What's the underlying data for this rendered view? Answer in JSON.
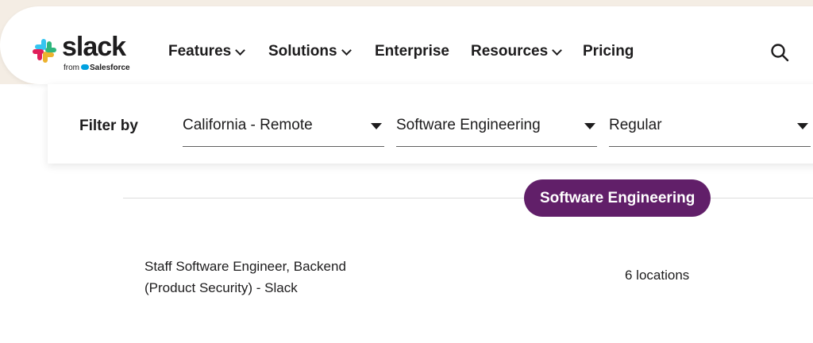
{
  "header": {
    "logo_text": "slack",
    "logo_sub_prefix": "from",
    "logo_sub_brand": "Salesforce",
    "nav": [
      {
        "label": "Features",
        "has_dropdown": true
      },
      {
        "label": "Solutions",
        "has_dropdown": true
      },
      {
        "label": "Enterprise",
        "has_dropdown": false
      },
      {
        "label": "Resources",
        "has_dropdown": true
      },
      {
        "label": "Pricing",
        "has_dropdown": false
      }
    ],
    "search_icon": "search-icon"
  },
  "filters": {
    "label": "Filter by",
    "location": "California - Remote",
    "team": "Software Engineering",
    "type": "Regular"
  },
  "section": {
    "category": "Software Engineering"
  },
  "jobs": [
    {
      "title_line1": "Staff Software Engineer, Backend",
      "title_line2": "(Product Security) - Slack",
      "locations": "6 locations"
    }
  ],
  "colors": {
    "accent_aubergine": "#611f69",
    "background_beige": "#f4ede4",
    "salesforce_blue": "#00a1e0"
  }
}
